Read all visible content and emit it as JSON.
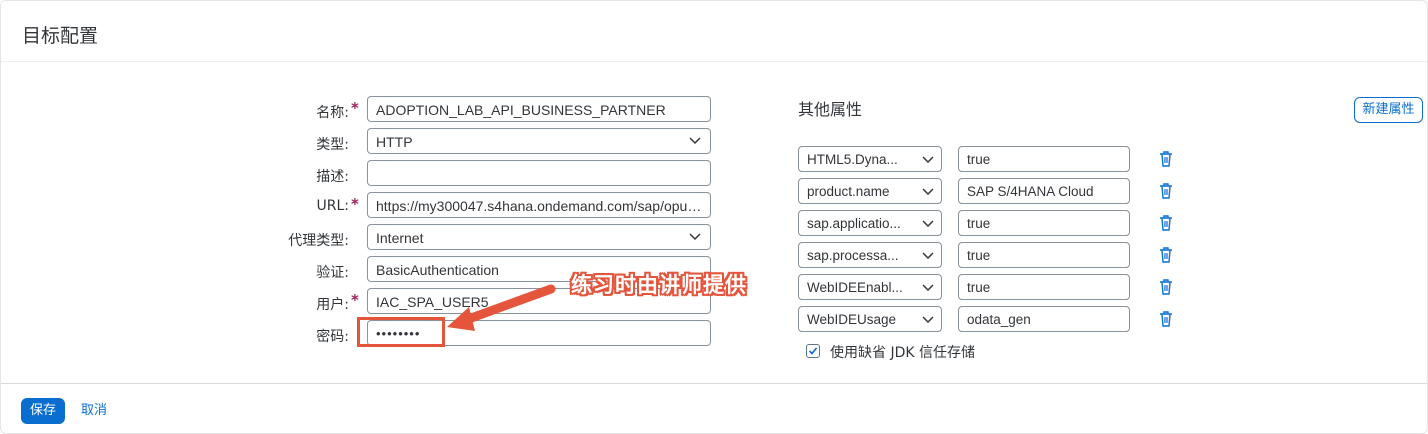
{
  "page": {
    "title": "目标配置"
  },
  "form": {
    "name_label": "名称:",
    "name_value": "ADOPTION_LAB_API_BUSINESS_PARTNER",
    "type_label": "类型:",
    "type_value": "HTTP",
    "desc_label": "描述:",
    "desc_value": "",
    "url_label": "URL:",
    "url_value": "https://my300047.s4hana.ondemand.com/sap/opu/...",
    "proxy_label": "代理类型:",
    "proxy_value": "Internet",
    "auth_label": "验证:",
    "auth_value": "BasicAuthentication",
    "user_label": "用户:",
    "user_value": "IAC_SPA_USER5",
    "password_label": "密码:",
    "password_value": "••••••••",
    "required_mark": "*"
  },
  "properties": {
    "title": "其他属性",
    "new_button": "新建属性",
    "rows": [
      {
        "key": "HTML5.Dyna...",
        "value": "true"
      },
      {
        "key": "product.name",
        "value": "SAP S/4HANA Cloud"
      },
      {
        "key": "sap.applicatio...",
        "value": "true"
      },
      {
        "key": "sap.processa...",
        "value": "true"
      },
      {
        "key": "WebIDEEnabl...",
        "value": "true"
      },
      {
        "key": "WebIDEUsage",
        "value": "odata_gen"
      }
    ],
    "jdk_checkbox_label": "使用缺省 JDK 信任存储",
    "jdk_checkbox_checked": true
  },
  "footer": {
    "save_label": "保存",
    "cancel_label": "取消"
  },
  "annotation": {
    "callout_text": "练习时由讲师提供",
    "color": "#e4553c"
  },
  "colors": {
    "accent": "#0a6ed1",
    "required": "#a1235f"
  }
}
